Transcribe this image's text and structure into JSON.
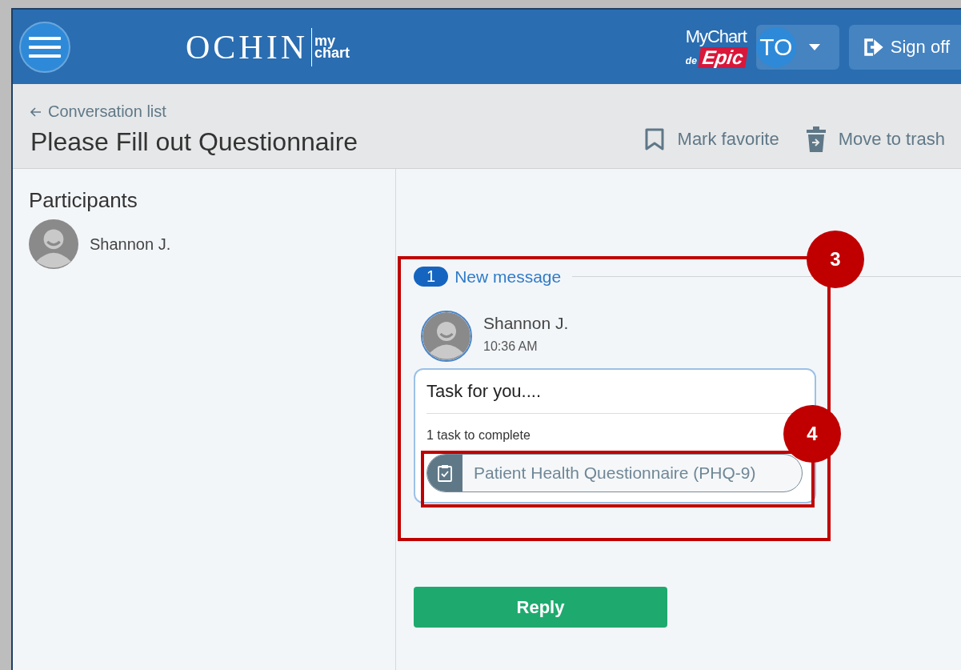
{
  "header": {
    "logo": {
      "brand": "OCHIN",
      "product_top": "my",
      "product_bottom": "chart"
    },
    "partner_logo": {
      "top": "MyChart",
      "by": "de",
      "brand": "Epic"
    },
    "user": {
      "initials": "TO"
    },
    "sign_off": "Sign off"
  },
  "toolbar": {
    "back_link": "Conversation list",
    "title": "Please Fill out Questionnaire",
    "actions": [
      {
        "kind": "favorite",
        "label": "Mark favorite"
      },
      {
        "kind": "trash",
        "label": "Move to trash"
      }
    ]
  },
  "participants": {
    "heading": "Participants",
    "people": [
      {
        "name": "Shannon J."
      }
    ]
  },
  "conversation": {
    "new_count": "1",
    "new_label": "New message",
    "messages": [
      {
        "sender": "Shannon J.",
        "time": "10:36 AM",
        "body": "Task for you....",
        "task_count": "1 task to complete",
        "tasks": [
          {
            "label": "Patient Health Questionnaire (PHQ-9)"
          }
        ]
      }
    ]
  },
  "reply_button": "Reply",
  "annotations": [
    {
      "label": "3"
    },
    {
      "label": "4"
    }
  ]
}
